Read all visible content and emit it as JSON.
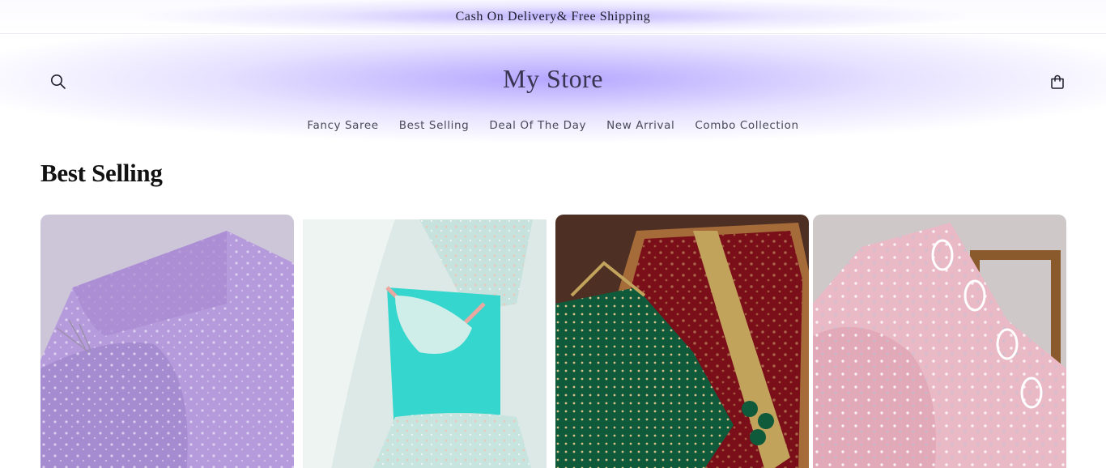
{
  "announcement": {
    "text": "Cash On Delivery& Free Shipping"
  },
  "header": {
    "logo": "My Store",
    "search_icon": "search-icon",
    "cart_icon": "cart-icon"
  },
  "nav": {
    "items": [
      {
        "label": "Fancy Saree"
      },
      {
        "label": "Best Selling"
      },
      {
        "label": "Deal Of The Day"
      },
      {
        "label": "New Arrival"
      },
      {
        "label": "Combo Collection"
      }
    ]
  },
  "section": {
    "title": "Best Selling",
    "products": [
      {
        "image": "lavender-saree-image",
        "accent": "#b89ad8"
      },
      {
        "image": "aqua-blouse-saree-image",
        "accent": "#3fd8cf"
      },
      {
        "image": "maroon-green-saree-image",
        "accent": "#7a0f1a"
      },
      {
        "image": "pink-saree-image",
        "accent": "#e9b9c6"
      }
    ]
  },
  "colors": {
    "header_glow": "#a896ff",
    "text": "#1a1a1a"
  }
}
